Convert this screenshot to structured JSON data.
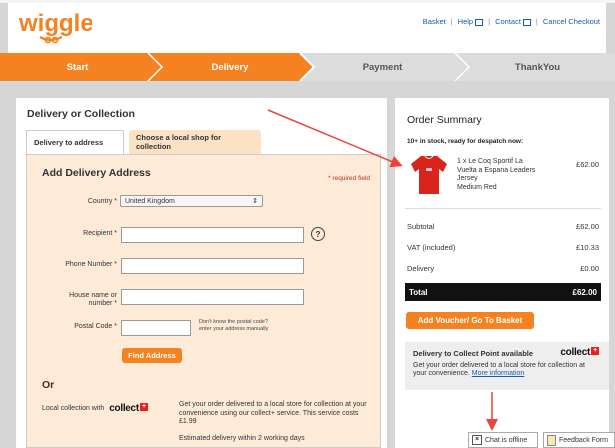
{
  "header": {
    "logo_text": "wiggle",
    "links": {
      "basket": "Basket",
      "help": "Help",
      "contact": "Contact",
      "cancel": "Cancel Checkout"
    }
  },
  "steps": [
    {
      "label": "Start",
      "active": true
    },
    {
      "label": "Delivery",
      "active": true
    },
    {
      "label": "Payment",
      "active": false
    },
    {
      "label": "ThankYou",
      "active": false
    }
  ],
  "delivery": {
    "section_title": "Delivery or Collection",
    "tabs": {
      "tab1": "Delivery to address",
      "tab2": "Choose a local shop for collection"
    },
    "form_title": "Add Delivery Address",
    "required_note": "* required field",
    "fields": {
      "country_label": "Country *",
      "country_value": "United Kingdom",
      "recipient_label": "Recipient *",
      "phone_label": "Phone Number *",
      "house_label_1": "House name or",
      "house_label_2": "number *",
      "postal_label": "Postal Code *",
      "postal_note_1": "Don't know the postal code?",
      "postal_note_2": "enter your address manually"
    },
    "find_address_button": "Find Address",
    "or_label": "Or",
    "local_collection_label": "Local collection with",
    "collect_logo": "collect",
    "collect_desc": "Get your order delivered to a local store for collection at your convenience using our collect+ service. This service costs £1.99",
    "estimated": "Estimated delivery within 2 working days"
  },
  "summary": {
    "title": "Order Summary",
    "stock_note": "10+ in stock, ready for despatch now:",
    "item": {
      "line1": "1 x Le Coq Sportif La",
      "line2": "Vuelta a Espana Leaders",
      "line3": "Jersey",
      "line4": "Medium Red",
      "price": "£62.00"
    },
    "subtotal_label": "Subtotal",
    "subtotal_value": "£62.00",
    "vat_label": "VAT (included)",
    "vat_value": "£10.33",
    "delivery_label": "Delivery",
    "delivery_value": "£0.00",
    "total_label": "Total",
    "total_value": "£62.00",
    "voucher_button": "Add Voucher/ Go To Basket",
    "collect_point": {
      "title": "Delivery to Collect Point available",
      "text": "Get your order delivered to a local store for collection at your convenience.",
      "link": "More information"
    }
  },
  "footer": {
    "chat": "Chat is offline",
    "feedback": "Feedback Form"
  },
  "colors": {
    "brand_orange": "#f58220",
    "link_blue": "#1a5aa8",
    "jersey_red": "#d8241b"
  }
}
